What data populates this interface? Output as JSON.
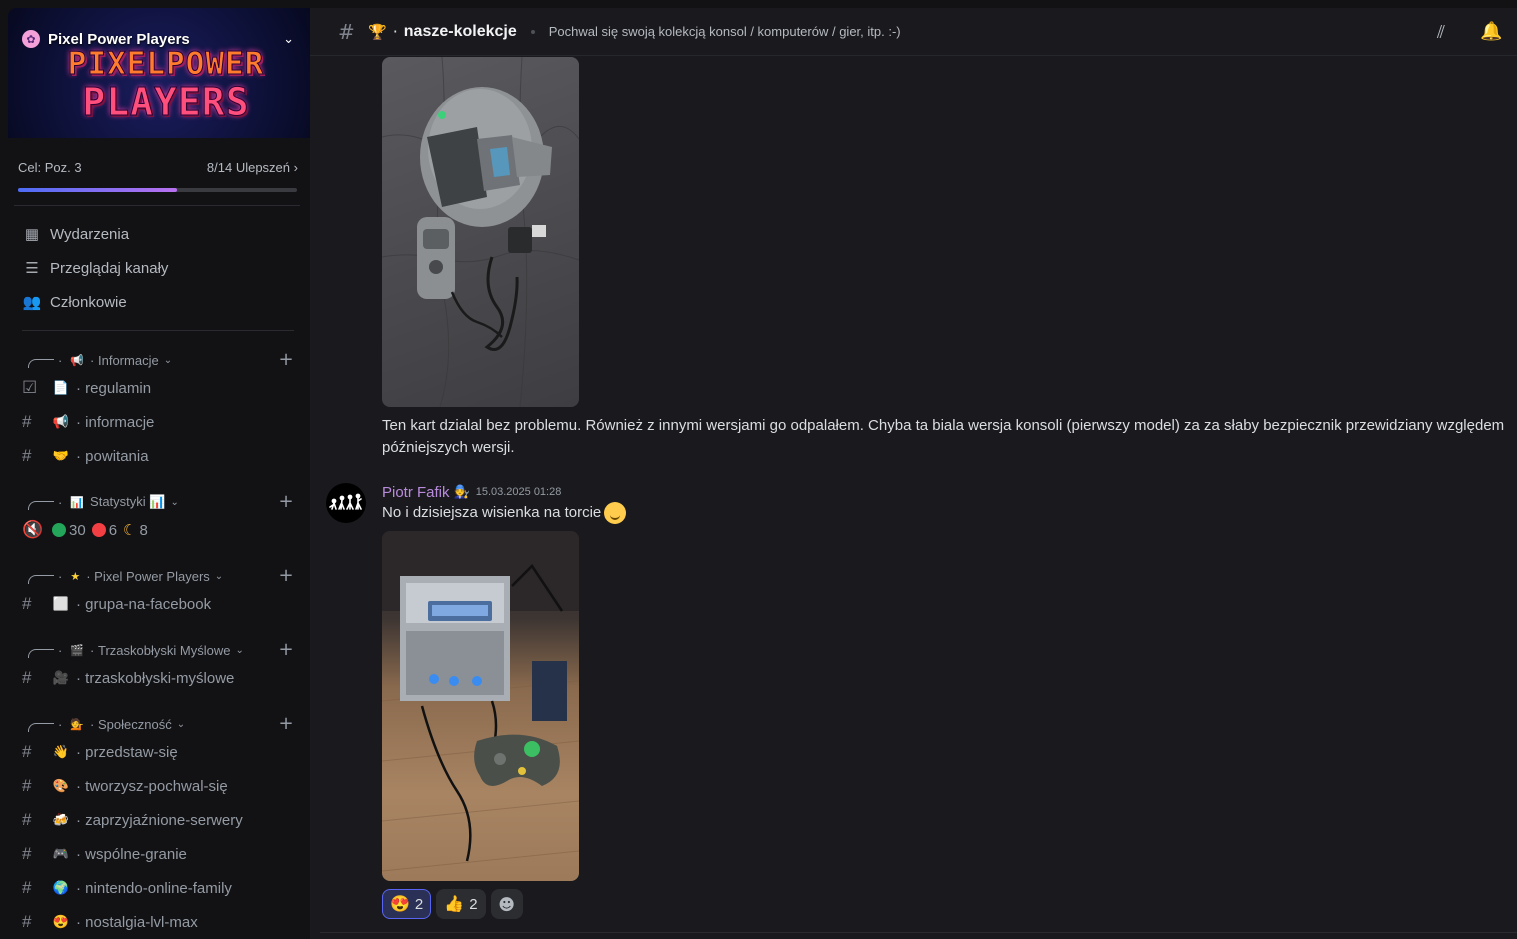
{
  "server": {
    "name": "Pixel Power Players",
    "logo_line1": "PIXELPOWER",
    "logo_line2": "PLAYERS",
    "boost_goal": "Cel: Poz. 3",
    "boost_count": "8/14 Ulepszeń",
    "boost_progress": 0.57
  },
  "nav": [
    {
      "label": "Wydarzenia",
      "icon": "calendar-icon"
    },
    {
      "label": "Przeglądaj kanały",
      "icon": "browse-channels-icon"
    },
    {
      "label": "Członkowie",
      "icon": "members-icon"
    }
  ],
  "categories": [
    {
      "name": "Informacje",
      "emoji": "📢"
    },
    {
      "name": "Statystyki 📊",
      "emoji": "📊"
    },
    {
      "name": "Pixel Power Players",
      "emoji": "★"
    },
    {
      "name": "Trzaskobłyski Myślowe",
      "emoji": "🎬"
    },
    {
      "name": "Społeczność",
      "emoji": "💁"
    }
  ],
  "channels": {
    "regulamin": {
      "name": "regulamin",
      "emoji": "📄"
    },
    "informacje": {
      "name": "informacje",
      "emoji": "📢"
    },
    "powitania": {
      "name": "powitania",
      "emoji": "🤝"
    },
    "stats": {
      "online": "30",
      "dnd": "6",
      "idle": "8"
    },
    "facebook": {
      "name": "grupa-na-facebook",
      "emoji": "⬜"
    },
    "trzaskoblyski": {
      "name": "trzaskobłyski-myślowe",
      "emoji": "🎥"
    },
    "przedstaw": {
      "name": "przedstaw-się",
      "emoji": "👋"
    },
    "tworzysz": {
      "name": "tworzysz-pochwal-się",
      "emoji": "🎨"
    },
    "serwery": {
      "name": "zaprzyjaźnione-serwery",
      "emoji": "🍻"
    },
    "granie": {
      "name": "wspólne-granie",
      "emoji": "🎮"
    },
    "nintendo": {
      "name": "nintendo-online-family",
      "emoji": "🌍"
    },
    "nostalgia": {
      "name": "nostalgia-lvl-max",
      "emoji": "😍"
    }
  },
  "header": {
    "channel_emoji": "🏆",
    "channel_name": "nasze-kolekcje",
    "topic": "Pochwal się swoją kolekcją konsol / komputerów / gier, itp. :-)"
  },
  "messages": [
    {
      "text": "Ten kart dzialal bez problemu. Również z innymi wersjami go odpalałem. Chyba ta biala wersja konsoli (pierwszy model) za za słaby bezpiecznik przewidziany względem późniejszych wersji."
    },
    {
      "author": "Piotr Fafik",
      "author_badge": "🧑‍🔧",
      "timestamp": "15.03.2025 01:28",
      "text": "No i dzisiejsza wisienka na torcie"
    }
  ],
  "reactions": [
    {
      "emoji": "😍",
      "count": "2",
      "active": true
    },
    {
      "emoji": "👍",
      "count": "2",
      "active": false
    }
  ],
  "colors": {
    "accent": "#5865f2",
    "author": "#b98bdc",
    "status_online": "#23a55a",
    "status_dnd": "#f23f43",
    "status_idle": "#f0b232"
  }
}
